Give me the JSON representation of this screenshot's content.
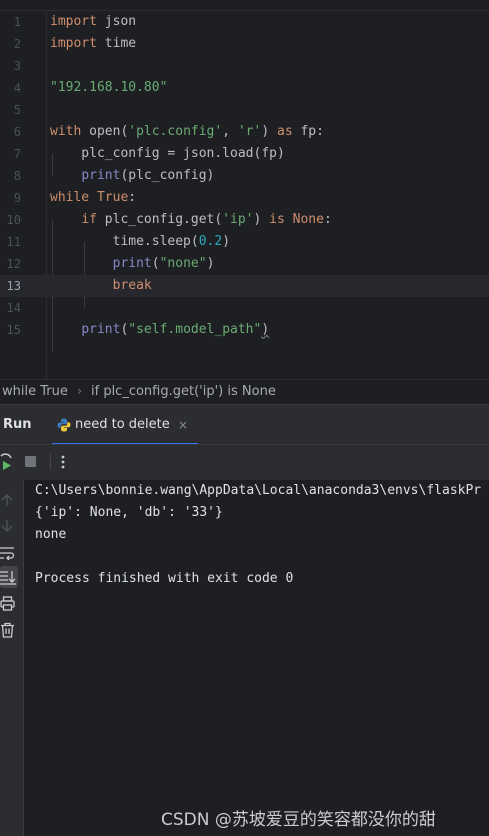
{
  "editor": {
    "lines": [
      {
        "num": "1"
      },
      {
        "num": "2"
      },
      {
        "num": "3"
      },
      {
        "num": "4"
      },
      {
        "num": "5"
      },
      {
        "num": "6"
      },
      {
        "num": "7"
      },
      {
        "num": "8"
      },
      {
        "num": "9"
      },
      {
        "num": "10"
      },
      {
        "num": "11"
      },
      {
        "num": "12"
      },
      {
        "num": "13"
      },
      {
        "num": "14"
      },
      {
        "num": "15"
      }
    ],
    "current_line": "13",
    "code": {
      "l1_kw": "import",
      "l1_rest": " json",
      "l2_kw": "import",
      "l2_rest": " time",
      "l4_str": "\"192.168.10.80\"",
      "l6_kw1": "with",
      "l6_fn": " open(",
      "l6_s1": "'plc.config'",
      "l6_c": ", ",
      "l6_s2": "'r'",
      "l6_p": ") ",
      "l6_kw2": "as",
      "l6_rest": " fp:",
      "l7": "    plc_config = json.load(fp)",
      "l8_indent": "    ",
      "l8_bi": "print",
      "l8_rest": "(plc_config)",
      "l9_kw1": "while",
      "l9_sp": " ",
      "l9_kw2": "True",
      "l9_rest": ":",
      "l10_indent": "    ",
      "l10_kw1": "if",
      "l10_mid": " plc_config.get(",
      "l10_s": "'ip'",
      "l10_p": ") ",
      "l10_kw2": "is",
      "l10_sp": " ",
      "l10_kw3": "None",
      "l10_rest": ":",
      "l11_pre": "        time.sleep(",
      "l11_num": "0.2",
      "l11_rest": ")",
      "l12_indent": "        ",
      "l12_bi": "print",
      "l12_p": "(",
      "l12_s": "\"none\"",
      "l12_rest": ")",
      "l13_indent": "        ",
      "l13_kw": "break",
      "l15_indent": "    ",
      "l15_bi": "print",
      "l15_p": "(",
      "l15_s": "\"self.model_path\"",
      "l15_rest": ")"
    }
  },
  "breadcrumb": {
    "item1": "while True",
    "separator": "›",
    "item2": "if plc_config.get('ip') is None"
  },
  "run_panel": {
    "title": "Run",
    "tab_label": "need to delete",
    "tab_close": "×",
    "console_lines": [
      "C:\\Users\\bonnie.wang\\AppData\\Local\\anaconda3\\envs\\flaskPr",
      "{'ip': None, 'db': '33'}",
      "none",
      "",
      "Process finished with exit code 0"
    ]
  },
  "watermark": "CSDN @苏坡爱豆的笑容都没你的甜",
  "colors": {
    "background": "#1e1f22",
    "keyword": "#cf8e6d",
    "string": "#6aab73",
    "number": "#2aacb8",
    "builtin": "#8888c6",
    "accent": "#3574f0"
  }
}
